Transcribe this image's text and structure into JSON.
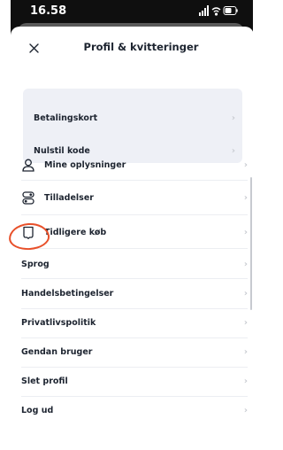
{
  "status_bar": {
    "time": "16.58"
  },
  "header": {
    "close_icon": "close-icon",
    "title": "Profil & kvitteringer"
  },
  "group_items": [
    {
      "label": "Betalingskort"
    },
    {
      "label": "Nulstil kode"
    }
  ],
  "menu_items": [
    {
      "label": "Mine oplysninger",
      "icon": "person-icon"
    },
    {
      "label": "Tilladelser",
      "icon": "toggles-icon"
    },
    {
      "label": "Tidligere køb",
      "icon": "receipt-icon"
    },
    {
      "label": "Sprog",
      "icon": null
    },
    {
      "label": "Handelsbetingelser",
      "icon": null
    },
    {
      "label": "Privatlivspolitik",
      "icon": null
    },
    {
      "label": "Gendan bruger",
      "icon": null
    },
    {
      "label": "Slet profil",
      "icon": null
    },
    {
      "label": "Log ud",
      "icon": null
    }
  ],
  "colors": {
    "annotation": "#e8502a",
    "group_bg": "#eef0f6",
    "text": "#1d2430"
  }
}
